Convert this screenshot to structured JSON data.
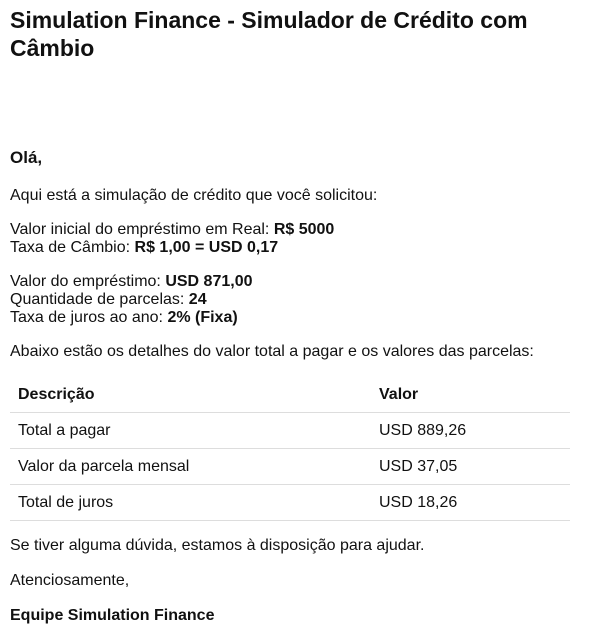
{
  "title": "Simulation Finance - Simulador de Crédito com Câmbio",
  "greeting": "Olá,",
  "intro": "Aqui está a simulação de crédito que você solicitou:",
  "initial_loan": {
    "label": "Valor inicial do empréstimo em Real: ",
    "value": "R$ 5000"
  },
  "exchange_rate": {
    "label": "Taxa de Câmbio: ",
    "value": "R$ 1,00 = USD 0,17"
  },
  "loan_value": {
    "label": "Valor do empréstimo: ",
    "value": "USD 871,00"
  },
  "installments": {
    "label": "Quantidade de parcelas: ",
    "value": "24"
  },
  "interest_rate": {
    "label": "Taxa de juros ao ano: ",
    "value": "2% (Fixa)"
  },
  "table_lead": "Abaixo estão os detalhes do valor total a pagar e os valores das parcelas:",
  "table": {
    "headers": [
      "Descrição",
      "Valor"
    ],
    "rows": [
      [
        "Total a pagar",
        "USD 889,26"
      ],
      [
        "Valor da parcela mensal",
        "USD 37,05"
      ],
      [
        "Total de juros",
        "USD 18,26"
      ]
    ]
  },
  "help": "Se tiver alguma dúvida, estamos à disposição para ajudar.",
  "regards": "Atenciosamente,",
  "signature": "Equipe Simulation Finance"
}
